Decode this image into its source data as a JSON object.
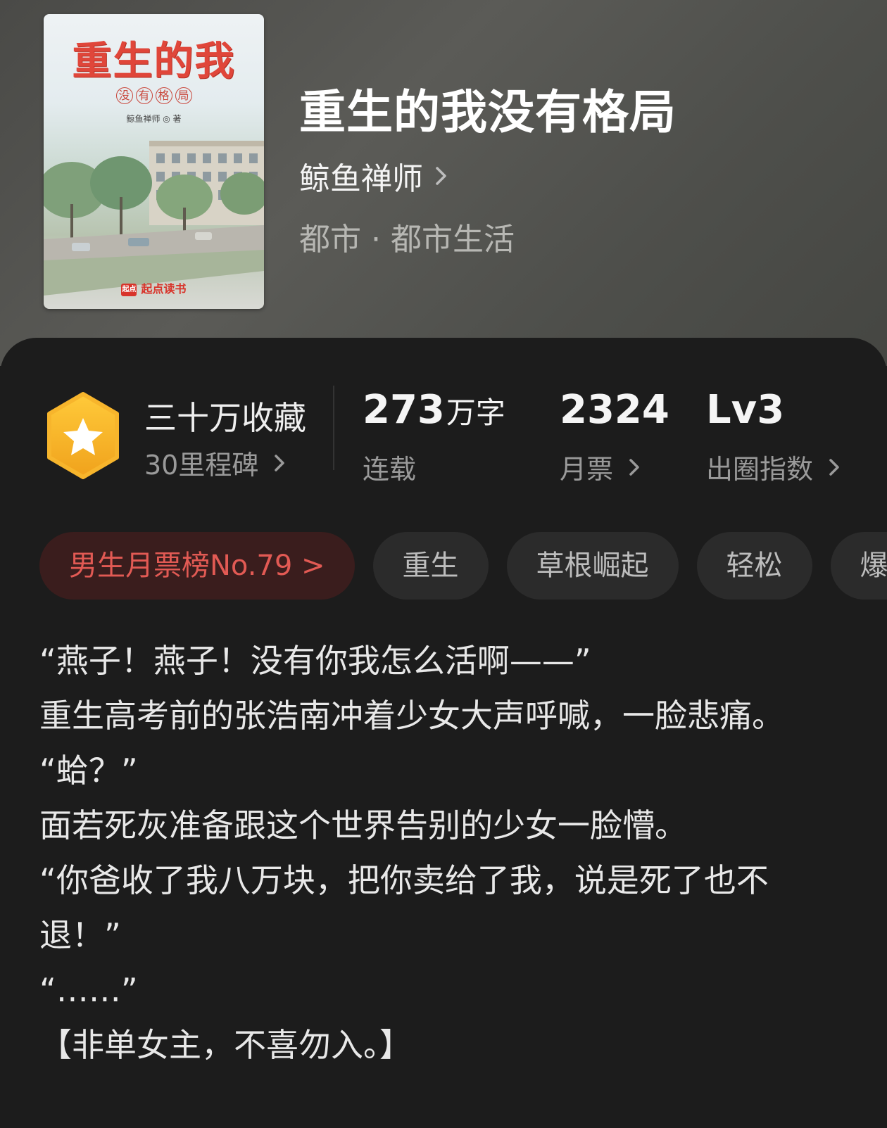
{
  "cover": {
    "title": "重生的我",
    "subtitle_chars": [
      "没",
      "有",
      "格",
      "局"
    ],
    "author_line": "鲸鱼禅师 ◎ 著",
    "brand": "起点读书",
    "brand_logo": "起点",
    "accent_color": "#e0463a"
  },
  "book": {
    "title": "重生的我没有格局",
    "author": "鲸鱼禅师",
    "genre": "都市 · 都市生活"
  },
  "stats": {
    "medal_icon": "star-hexagon-icon",
    "favorites_label": "三十万收藏",
    "milestone_label": "30里程碑",
    "word_count_number": "273",
    "word_count_unit": "万字",
    "status_label": "连载",
    "monthly_tickets": "2324",
    "monthly_tickets_label": "月票",
    "level": "Lv3",
    "influence_label": "出圈指数"
  },
  "tags": [
    "男生月票榜No.79 >",
    "重生",
    "草根崛起",
    "轻松",
    "爆笑"
  ],
  "description": [
    "“燕子！燕子！没有你我怎么活啊——”",
    "重生高考前的张浩南冲着少女大声呼喊，一脸悲痛。",
    "“蛤？”",
    "面若死灰准备跟这个世界告别的少女一脸懵。",
    "“你爸收了我八万块，把你卖给了我，说是死了也不退！”",
    "“……”",
    "【非单女主，不喜勿入。】"
  ],
  "colors": {
    "rank_tag_text": "#e25a54",
    "medal_gold": "#f5b52a"
  }
}
